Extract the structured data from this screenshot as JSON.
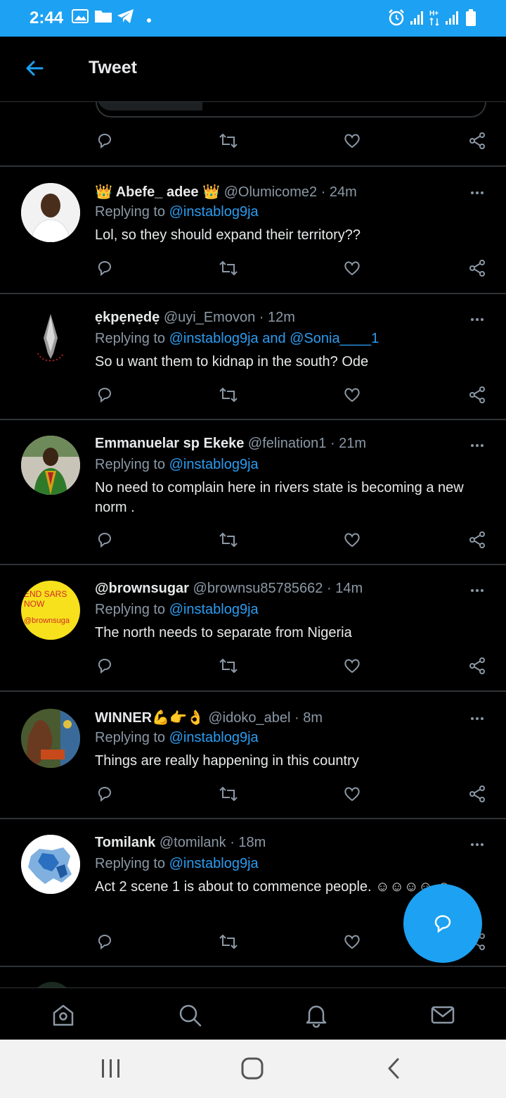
{
  "status_bar": {
    "time": "2:44"
  },
  "header": {
    "title": "Tweet"
  },
  "tweets": [
    {
      "name": "👑 Abefe_ adee 👑",
      "handle": "@Olumicome2",
      "time": "· 24m",
      "replying_label": "Replying to",
      "replying_to": "@instablog9ja",
      "text": "Lol, so they should expand their territory??"
    },
    {
      "name": "ẹkpẹnẹdẹ",
      "handle": "@uyi_Emovon",
      "time": "· 12m",
      "replying_label": "Replying to",
      "replying_to": "@instablog9ja and @Sonia____1",
      "text": "So u want them to kidnap in the south?  Ode"
    },
    {
      "name": "Emmanuelar sp Ekeke",
      "handle": "@felination1",
      "time": "· 21m",
      "replying_label": "Replying to",
      "replying_to": "@instablog9ja",
      "text": "No need to complain here in rivers state is becoming a new norm ."
    },
    {
      "name": "@brownsugar",
      "handle": "@brownsu85785662",
      "time": "· 14m",
      "replying_label": "Replying to",
      "replying_to": "@instablog9ja",
      "text": "The north needs to separate from Nigeria",
      "avatar_text": [
        "END SARS",
        "NOW",
        "@brownsuga"
      ]
    },
    {
      "name": "WINNER💪👉👌",
      "handle": "@idoko_abel",
      "time": "· 8m",
      "replying_label": "Replying to",
      "replying_to": "@instablog9ja",
      "text": "Things are really happening in this country"
    },
    {
      "name": "Tomilank",
      "handle": "@tomilank",
      "time": "· 18m",
      "replying_label": "Replying to",
      "replying_to": "@instablog9ja",
      "text": "Act 2 scene 1 is about to commence people. ☺☺☺☺ ☺"
    }
  ],
  "colors": {
    "accent": "#1da1f2",
    "link": "#2b9cf0",
    "muted": "#8b98a5",
    "background": "#000000"
  },
  "icons": [
    "back-arrow-icon",
    "reply-icon",
    "retweet-icon",
    "like-icon",
    "share-icon",
    "more-icon",
    "home-icon",
    "search-icon",
    "notifications-icon",
    "messages-icon",
    "compose-reply-icon"
  ]
}
